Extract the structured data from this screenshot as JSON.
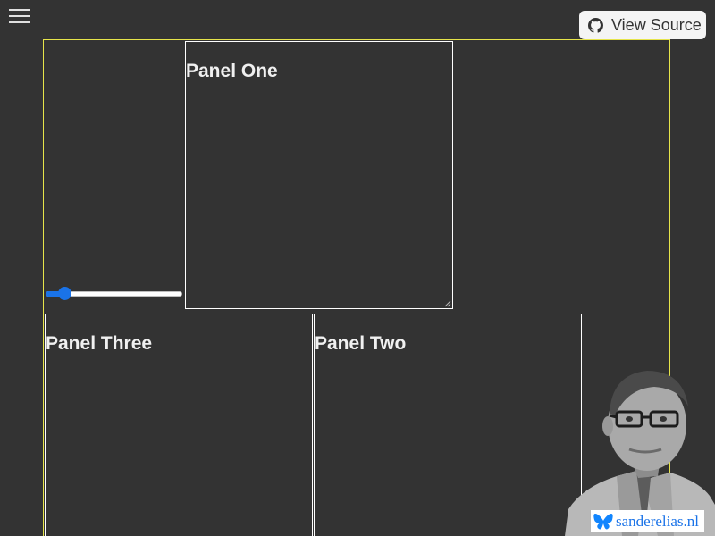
{
  "header": {
    "menu_icon": "hamburger-menu-icon",
    "view_source": {
      "icon": "github-icon",
      "label": "View Source"
    }
  },
  "controls": {
    "slider": {
      "value_fraction": 0.1
    }
  },
  "panels": [
    {
      "title": "Panel One"
    },
    {
      "title": "Panel Three"
    },
    {
      "title": "Panel Two"
    }
  ],
  "branding": {
    "icon": "butterfly-icon",
    "site": "sanderelias.nl"
  },
  "colors": {
    "background": "#333333",
    "container_border": "#e6e44a",
    "panel_border": "#ffffff",
    "accent": "#1a73e8"
  }
}
